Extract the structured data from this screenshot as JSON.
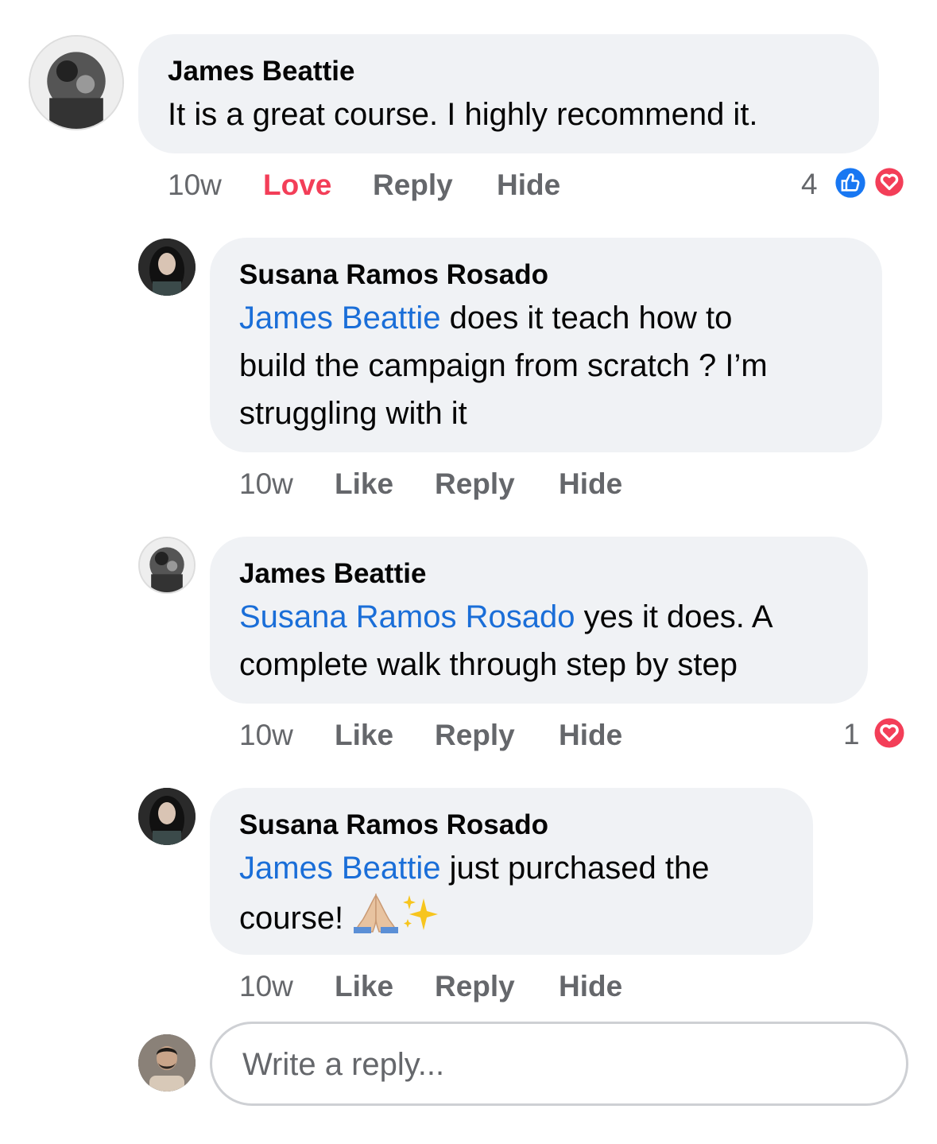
{
  "comments": [
    {
      "author": "James Beattie",
      "text": "It is a great course. I highly recommend it.",
      "time": "10w",
      "actions": [
        "Love",
        "Reply",
        "Hide"
      ],
      "reaction_count": "4",
      "reactions": [
        "like-icon",
        "love-icon"
      ]
    },
    {
      "author": "Susana Ramos Rosado",
      "mention": "James Beattie",
      "text_lines": [
        " does it teach how to",
        "build the campaign from scratch ? I’m",
        "struggling with it"
      ],
      "time": "10w",
      "actions": [
        "Like",
        "Reply",
        "Hide"
      ]
    },
    {
      "author": "James Beattie",
      "mention": "Susana Ramos Rosado",
      "text_lines": [
        " yes it does. A",
        "complete walk through step by step"
      ],
      "time": "10w",
      "actions": [
        "Like",
        "Reply",
        "Hide"
      ],
      "reaction_count": "1",
      "reactions": [
        "love-icon"
      ]
    },
    {
      "author": "Susana Ramos Rosado",
      "mention": "James Beattie",
      "text_lines": [
        " just purchased the",
        "course! "
      ],
      "emojis": [
        "folded-hands-icon",
        "sparkles-icon"
      ],
      "time": "10w",
      "actions": [
        "Like",
        "Reply",
        "Hide"
      ]
    }
  ],
  "reply_box": {
    "placeholder": "Write a reply..."
  },
  "colors": {
    "bubble": "#f0f2f5",
    "mention": "#1a6ed8",
    "love": "#f33e58",
    "like": "#1877f2",
    "meta": "#65676b"
  }
}
